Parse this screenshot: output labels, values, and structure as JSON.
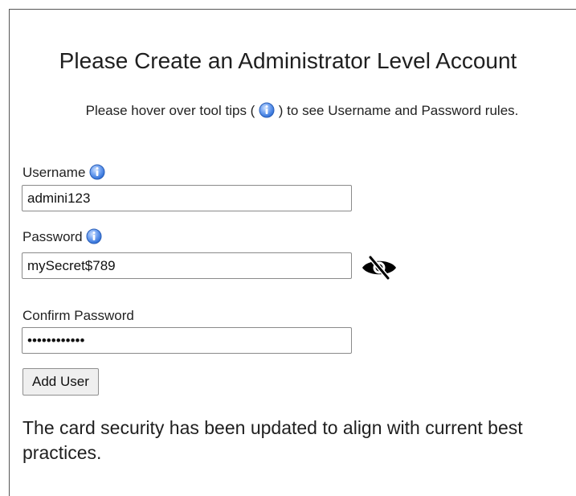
{
  "form": {
    "title": "Please Create an Administrator Level Account",
    "hint_before": "Please hover over tool tips (",
    "hint_after": ") to see Username and Password rules.",
    "username": {
      "label": "Username",
      "value": "admini123"
    },
    "password": {
      "label": "Password",
      "value": "mySecret$789"
    },
    "confirm_password": {
      "label": "Confirm Password",
      "value": "mySecret$789"
    },
    "add_user_label": "Add User",
    "notice": "The card security has been updated to align with current best practices."
  },
  "icons": {
    "tooltip": "info-icon",
    "password_visibility": "eye-slash-icon"
  },
  "colors": {
    "info_icon": "#2f6fd6",
    "eye_icon": "#000000"
  }
}
